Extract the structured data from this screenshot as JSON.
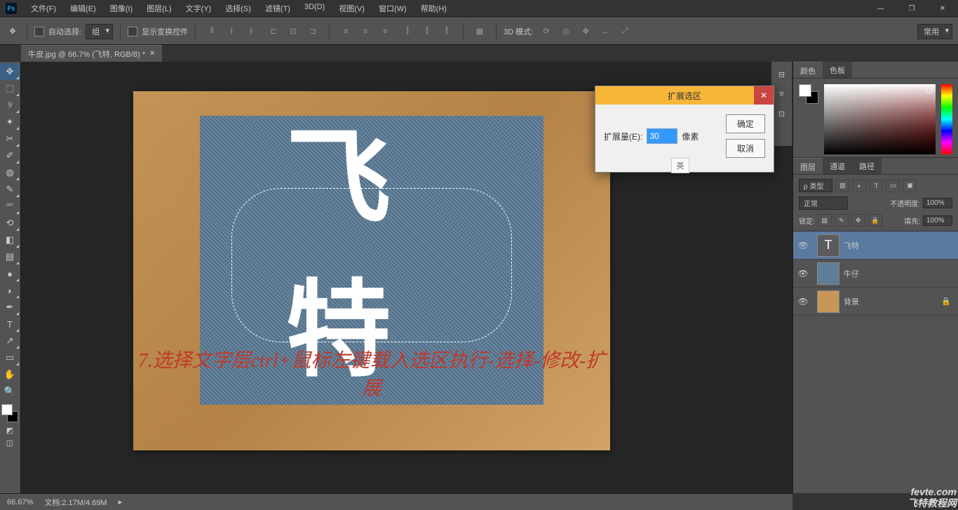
{
  "titlebar": {
    "logo": "Ps"
  },
  "menu": {
    "file": "文件(F)",
    "edit": "编辑(E)",
    "image": "图像(I)",
    "layer": "图层(L)",
    "type": "文字(Y)",
    "select": "选择(S)",
    "filter": "滤镜(T)",
    "threed": "3D(D)",
    "view": "视图(V)",
    "window": "窗口(W)",
    "help": "帮助(H)"
  },
  "options": {
    "auto_select": "自动选择:",
    "group": "组",
    "show_controls": "显示变换控件",
    "threed_mode": "3D 模式:",
    "preset": "常用"
  },
  "doc_tab": {
    "label": "牛皮.jpg @ 66.7% (飞特, RGB/8) *"
  },
  "tutorial": "7.选择文字层ctrl+鼠标左键载入选区执行-选择-修改-扩展",
  "dialog": {
    "title": "扩展选区",
    "expand_label": "扩展量(E):",
    "value": "30",
    "unit": "像素",
    "ime": "英",
    "ok": "确定",
    "cancel": "取消"
  },
  "panels": {
    "color_tab": "颜色",
    "swatches_tab": "色板",
    "layers_tab": "图层",
    "channels_tab": "通道",
    "paths_tab": "路径",
    "kind": "ρ 类型",
    "blend": "正常",
    "opacity_label": "不透明度:",
    "opacity": "100%",
    "lock_label": "锁定:",
    "fill_label": "填充:",
    "fill": "100%"
  },
  "layers": {
    "l1": "飞特",
    "l2": "牛仔",
    "l3": "背景"
  },
  "status": {
    "zoom": "66.67%",
    "doc": "文档:2.17M/4.69M"
  },
  "symbols": {
    "min": "—",
    "restore": "❐",
    "close": "✕",
    "eye": "👁",
    "lock": "🔒",
    "arrow": "↕",
    "brush": "✎",
    "crop": "✂",
    "eyedrop": "✐",
    "heal": "◍",
    "clone": "⎃",
    "eraser": "◧",
    "bucket": "◢",
    "blur": "●",
    "dodge": "◗",
    "pen": "✒",
    "text": "T",
    "path": "↗",
    "shape": "▭",
    "hand": "✋",
    "zoom_tool": "🔍",
    "move": "✥",
    "marquee": "⬚",
    "lasso": "୨",
    "wand": "✦",
    "history": "⟲",
    "grad": "▤",
    "dim": "◫"
  },
  "watermark": {
    "line1": "fevte.com",
    "line2": "飞特教程网"
  }
}
